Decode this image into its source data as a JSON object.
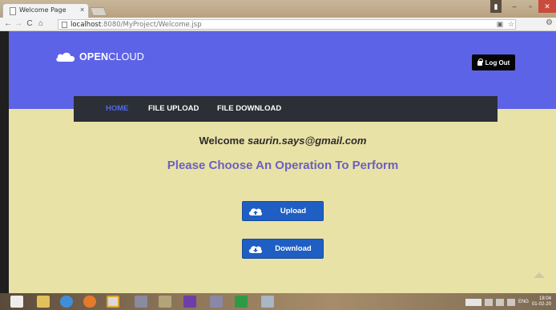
{
  "browser": {
    "tab_title": "Welcome Page",
    "tab_close": "×",
    "url_host": "localhost",
    "url_rest": ":8080/MyProject/Welcome.jsp",
    "window_min": "–",
    "window_max": "▫",
    "window_close": "✕"
  },
  "header": {
    "logo_bold": "OPEN",
    "logo_rest": "CLOUD",
    "logout_label": "Log Out"
  },
  "nav": {
    "items": [
      {
        "label": "HOME",
        "active": true
      },
      {
        "label": "FILE UPLOAD",
        "active": false
      },
      {
        "label": "FILE DOWNLOAD",
        "active": false
      }
    ]
  },
  "main": {
    "welcome_prefix": "Welcome",
    "email": "saurin.says@gmail.com",
    "heading": "Please Choose An Operation To Perform",
    "upload_label": "Upload",
    "download_label": "Download"
  },
  "taskbar": {
    "language": "ENG",
    "time": "18:04",
    "date": "01-02-20"
  },
  "colors": {
    "header_bg": "#5d63e6",
    "page_bg": "#e9e2a6",
    "nav_bg": "#2c2f36",
    "nav_active": "#4f6be8",
    "button_bg": "#1f5fc4",
    "heading_color": "#6a60c0"
  }
}
